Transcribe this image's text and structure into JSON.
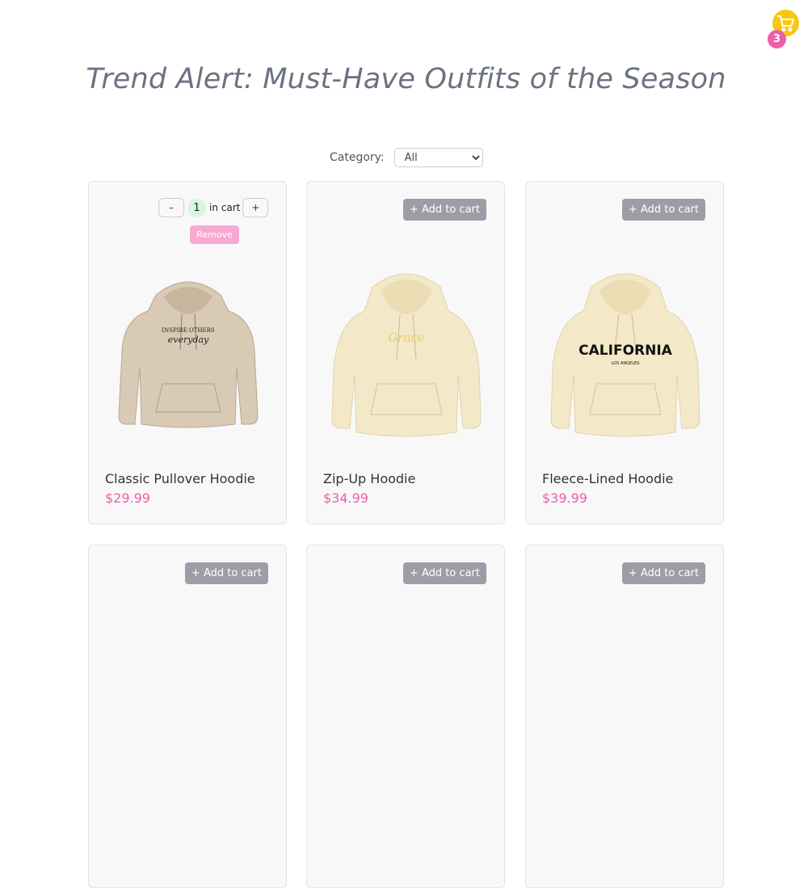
{
  "header": {
    "title": "Trend Alert: Must-Have Outfits of the Season",
    "cart_count": "3"
  },
  "filter": {
    "label": "Category:",
    "selected": "All"
  },
  "cart_controls": {
    "minus": "–",
    "plus": "+",
    "qty": "1",
    "in_cart": "in cart",
    "remove": "Remove"
  },
  "add_label": "+ Add to cart",
  "products": [
    {
      "name": "Classic Pullover Hoodie",
      "price": "$29.99",
      "print_top": "INSPIRE OTHERS",
      "print_script": "everyday",
      "color": "#d9cab5"
    },
    {
      "name": "Zip-Up Hoodie",
      "price": "$34.99",
      "print_script": "Grace",
      "color": "#f3e8c8"
    },
    {
      "name": "Fleece-Lined Hoodie",
      "price": "$39.99",
      "print_top": "CALIFORNIA",
      "print_sub": "LOS ANGELES",
      "color": "#f3e8c8"
    },
    {
      "name": "",
      "price": ""
    },
    {
      "name": "",
      "price": ""
    },
    {
      "name": "",
      "price": ""
    }
  ],
  "colors": {
    "accent_pink": "#ec5fa9",
    "cart_yellow": "#f9c70f",
    "button_gray": "#9e9da6"
  },
  "icons": [
    "cart-icon"
  ]
}
